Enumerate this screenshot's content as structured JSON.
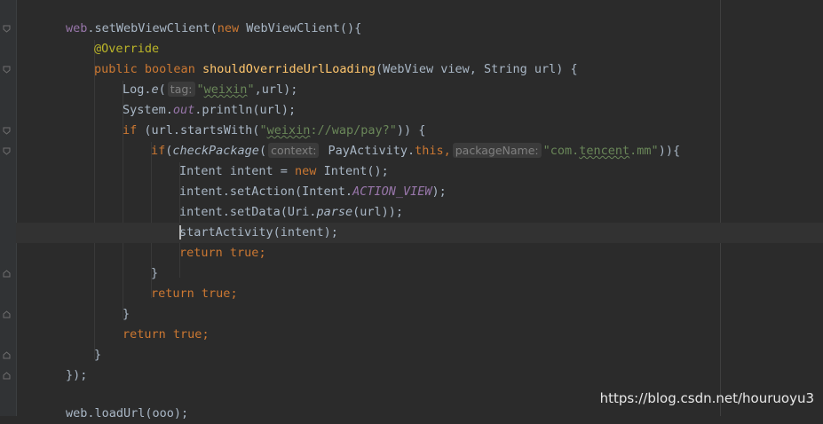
{
  "code": {
    "l1": {
      "obj": "web",
      "dot": ".",
      "method": "setWebViewClient",
      "p1": "(",
      "kw_new": "new",
      "rest": " WebViewClient(){"
    },
    "l2": {
      "annotation": "@Override"
    },
    "l3": {
      "kw_public": "public",
      "kw_boolean": "boolean",
      "method": "shouldOverrideUrlLoading",
      "params": "(WebView view, String url) {"
    },
    "l4": {
      "pre": "Log.",
      "method": "e",
      "open": "(",
      "hint": "tag:",
      "str_q1": "\"",
      "str_word": "weixin",
      "str_q2": "\"",
      "rest": ",url);"
    },
    "l5": {
      "pre": "System.",
      "field": "out",
      "rest": ".println(url);"
    },
    "l6": {
      "kw_if": "if",
      "pre": " (url.startsWith(",
      "str_q1": "\"",
      "str_word": "weixin",
      "str_rest": "://wap/pay?\"",
      "rest": ")) {"
    },
    "l7": {
      "kw_if": "if",
      "open": "(",
      "method": "checkPackage",
      "open2": "(",
      "hint1": "context:",
      "mid": " PayActivity.",
      "kw_this": "this",
      "comma": ",",
      "hint2": "packageName:",
      "str_a": "\"com.",
      "str_word": "tencent",
      "str_b": ".mm\"",
      "rest": ")){"
    },
    "l8": {
      "pre": "Intent intent = ",
      "kw_new": "new",
      "rest": " Intent();"
    },
    "l9": {
      "pre": "intent.setAction(Intent.",
      "field": "ACTION_VIEW",
      "rest": ");"
    },
    "l10": {
      "pre": "intent.setData(Uri.",
      "method": "parse",
      "rest": "(url));"
    },
    "l11": {
      "method": "startActivity",
      "rest": "(intent);"
    },
    "l12": {
      "kw_return": "return",
      "kw_true": "true",
      "semi": ";"
    },
    "l13": {
      "brace": "}"
    },
    "l14": {
      "kw_return": "return",
      "kw_true": "true",
      "semi": ";"
    },
    "l15": {
      "brace": "}"
    },
    "l16": {
      "kw_return": "return",
      "kw_true": "true",
      "semi": ";"
    },
    "l17": {
      "brace": "}"
    },
    "l18": {
      "text": "});"
    },
    "l19": {
      "text": "web.loadUrl(ooo);"
    }
  },
  "watermark": "https://blog.csdn.net/houruoyu3",
  "colors": {
    "keyword": "#cc7832",
    "annotation": "#bbb529",
    "string": "#6a8759",
    "method": "#ffc66d",
    "field": "#9876aa",
    "text": "#a9b7c6",
    "background": "#2b2b2b"
  }
}
